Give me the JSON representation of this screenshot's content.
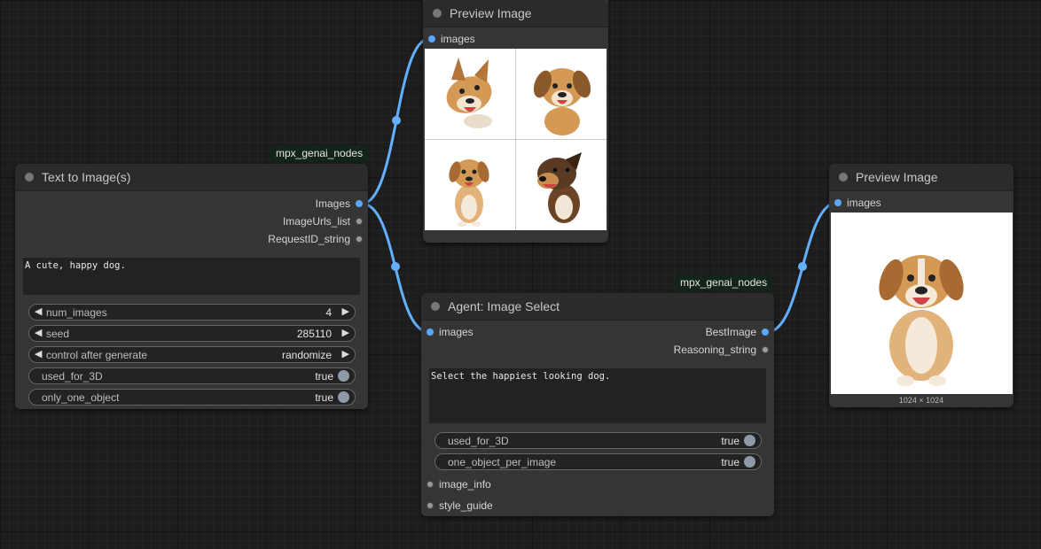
{
  "canvas": {
    "text_to_image": {
      "title": "Text to Image(s)",
      "badge": "mpx_genai_nodes",
      "outputs": [
        "Images",
        "ImageUrls_list",
        "RequestID_string"
      ],
      "prompt": "A cute, happy dog.",
      "widgets": [
        {
          "label": "num_images",
          "value": "4",
          "kind": "number"
        },
        {
          "label": "seed",
          "value": "285110",
          "kind": "number"
        },
        {
          "label": "control after generate",
          "value": "randomize",
          "kind": "combo"
        },
        {
          "label": "used_for_3D",
          "value": "true",
          "kind": "toggle"
        },
        {
          "label": "only_one_object",
          "value": "true",
          "kind": "toggle"
        }
      ]
    },
    "preview_top": {
      "title": "Preview Image",
      "input": "images"
    },
    "agent_select": {
      "title": "Agent: Image Select",
      "badge": "mpx_genai_nodes",
      "input": "images",
      "outputs": [
        "BestImage",
        "Reasoning_string"
      ],
      "prompt": "Select the happiest looking dog.",
      "widgets": [
        {
          "label": "used_for_3D",
          "value": "true",
          "kind": "toggle"
        },
        {
          "label": "one_object_per_image",
          "value": "true",
          "kind": "toggle"
        }
      ],
      "extra_inputs": [
        "image_info",
        "style_guide"
      ]
    },
    "preview_right": {
      "title": "Preview Image",
      "input": "images",
      "dimensions": "1024 × 1024"
    }
  },
  "colors": {
    "link": "#64b0ff",
    "node_bg": "#353535",
    "title_bg": "#2b2b2b",
    "badge_bg": "#13241a",
    "dog_fur": "#d49a55",
    "dog_dark": "#5a3a22"
  },
  "icons": {
    "decrement": "◀",
    "increment": "▶"
  }
}
